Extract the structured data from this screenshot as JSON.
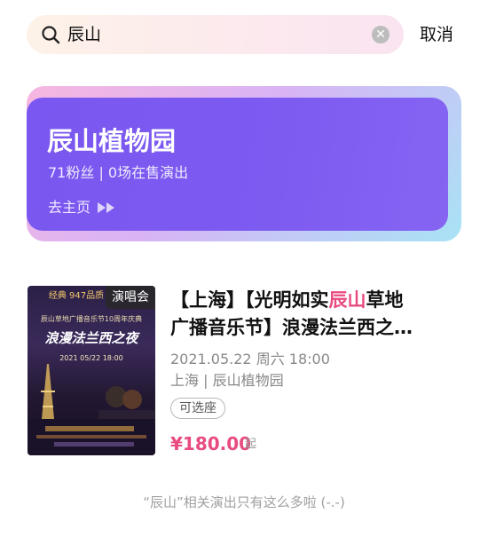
{
  "search": {
    "query": "辰山",
    "cancel_label": "取消"
  },
  "venue": {
    "name": "辰山植物园",
    "stats": "71粉丝 | 0场在售演出",
    "link_label": "去主页"
  },
  "show": {
    "category_tag": "演唱会",
    "title_prefix": "【上海】【光明如实",
    "title_highlight": "辰山",
    "title_suffix_line1": "草地",
    "title_line2": "广播音乐节】浪漫法兰西之…",
    "datetime": "2021.05.22 周六 18:00",
    "location": "上海 | 辰山植物园",
    "seat_badge": "可选座",
    "price": "¥180.00",
    "price_suffix": "起",
    "poster": {
      "top_text": "经典 947品质",
      "sub_text": "辰山草地广播音乐节10周年庆典",
      "title": "浪漫法兰西之夜",
      "date": "2021 05/22 18:00"
    }
  },
  "footer_note": "“辰山”相关演出只有这么多啦 (-.-)"
}
